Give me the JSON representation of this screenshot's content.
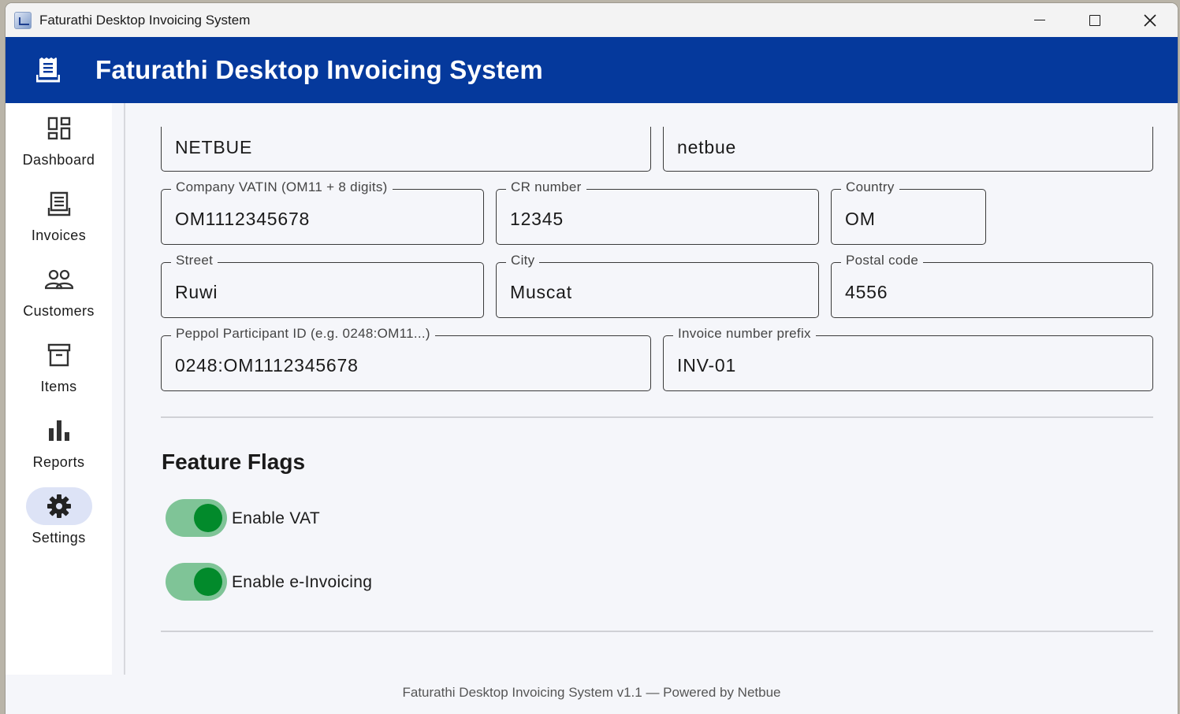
{
  "window": {
    "title": "Faturathi Desktop Invoicing System"
  },
  "header": {
    "title": "Faturathi Desktop Invoicing System",
    "icon": "invoice-icon",
    "background": "#05399c"
  },
  "sidebar": {
    "items": [
      {
        "label": "Dashboard",
        "icon": "dashboard-icon",
        "active": false
      },
      {
        "label": "Invoices",
        "icon": "invoice-icon",
        "active": false
      },
      {
        "label": "Customers",
        "icon": "people-icon",
        "active": false
      },
      {
        "label": "Items",
        "icon": "archive-box-icon",
        "active": false
      },
      {
        "label": "Reports",
        "icon": "bar-chart-icon",
        "active": false
      },
      {
        "label": "Settings",
        "icon": "gear-icon",
        "active": true
      }
    ]
  },
  "settings": {
    "company_name": {
      "value": "NETBUE"
    },
    "company_slug": {
      "value": "netbue"
    },
    "vatin": {
      "label": "Company VATIN (OM11 + 8 digits)",
      "value": "OM1112345678"
    },
    "cr_number": {
      "label": "CR number",
      "value": "12345"
    },
    "country": {
      "label": "Country",
      "value": "OM"
    },
    "street": {
      "label": "Street",
      "value": "Ruwi"
    },
    "city": {
      "label": "City",
      "value": "Muscat"
    },
    "postal_code": {
      "label": "Postal code",
      "value": "4556"
    },
    "peppol_id": {
      "label": "Peppol Participant ID (e.g. 0248:OM11...)",
      "value": "0248:OM1112345678"
    },
    "invoice_prefix": {
      "label": "Invoice number prefix",
      "value": "INV-01"
    }
  },
  "feature_flags": {
    "title": "Feature Flags",
    "enable_vat": {
      "label": "Enable VAT",
      "on": true
    },
    "enable_einvoicing": {
      "label": "Enable e-Invoicing",
      "on": true
    }
  },
  "footer": {
    "text": "Faturathi Desktop Invoicing System v1.1 — Powered by Netbue"
  }
}
